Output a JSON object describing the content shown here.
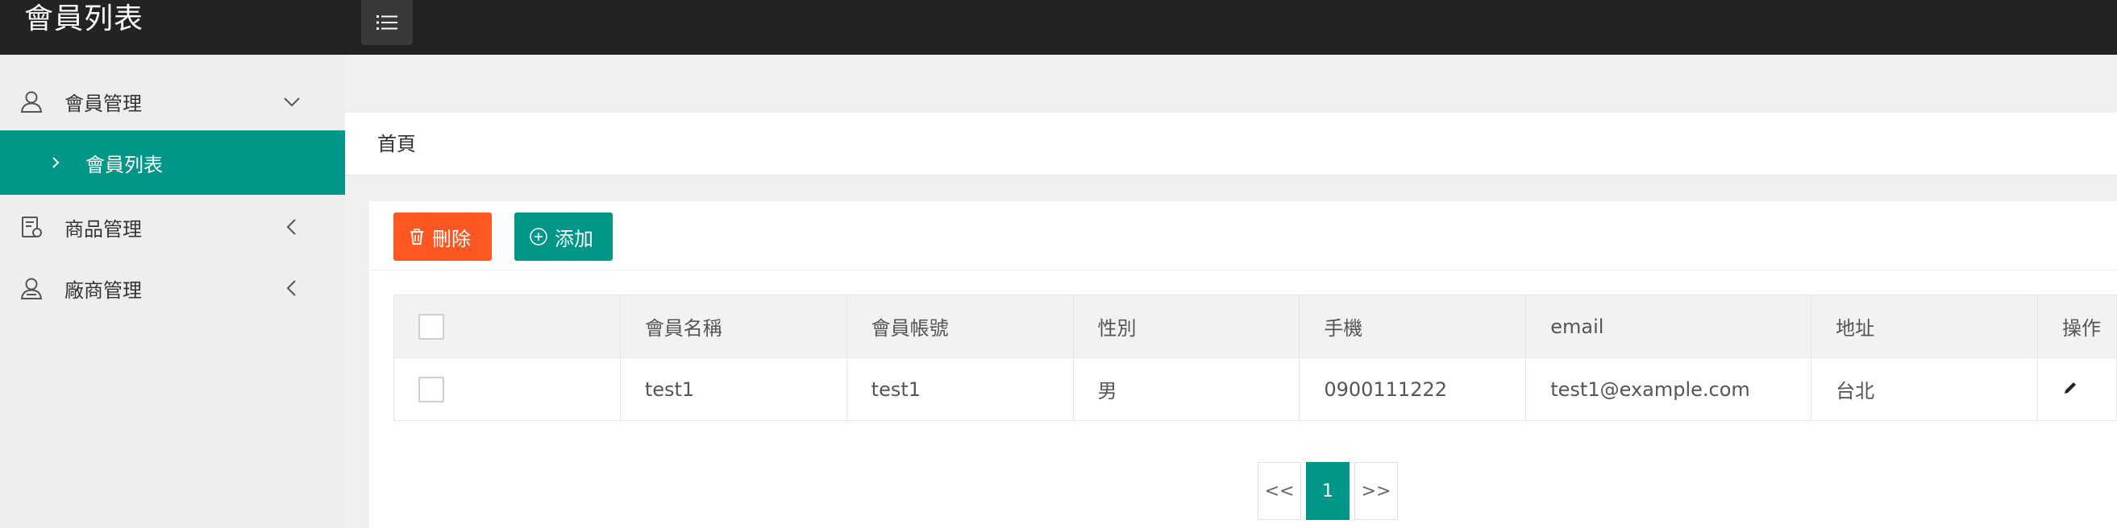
{
  "header": {
    "title": "會員列表",
    "menu_toggle_icon": "list-icon"
  },
  "sidebar": {
    "items": [
      {
        "label": "會員管理",
        "icon": "user-icon",
        "arrow": "chevron-down-icon"
      },
      {
        "label": "會員列表",
        "icon": "chevron-right-icon",
        "active": true
      },
      {
        "label": "商品管理",
        "icon": "product-icon",
        "arrow": "chevron-left-icon"
      },
      {
        "label": "廠商管理",
        "icon": "vendor-icon",
        "arrow": "chevron-left-icon"
      }
    ]
  },
  "breadcrumb": {
    "home": "首頁"
  },
  "toolbar": {
    "delete_label": "刪除",
    "delete_icon": "trash-icon",
    "add_label": "添加",
    "add_icon": "plus-circle-icon"
  },
  "table": {
    "columns": [
      "會員名稱",
      "會員帳號",
      "性別",
      "手機",
      "email",
      "地址",
      "操作"
    ],
    "rows": [
      {
        "name": "test1",
        "account": "test1",
        "gender": "男",
        "phone": "0900111222",
        "email": "test1@example.com",
        "address": "台北",
        "action_icon": "edit-icon"
      }
    ]
  },
  "pagination": {
    "prev": "<<",
    "current": "1",
    "next": ">>"
  },
  "colors": {
    "accent": "#009688",
    "danger": "#ff5722",
    "header_bg": "#232323"
  }
}
